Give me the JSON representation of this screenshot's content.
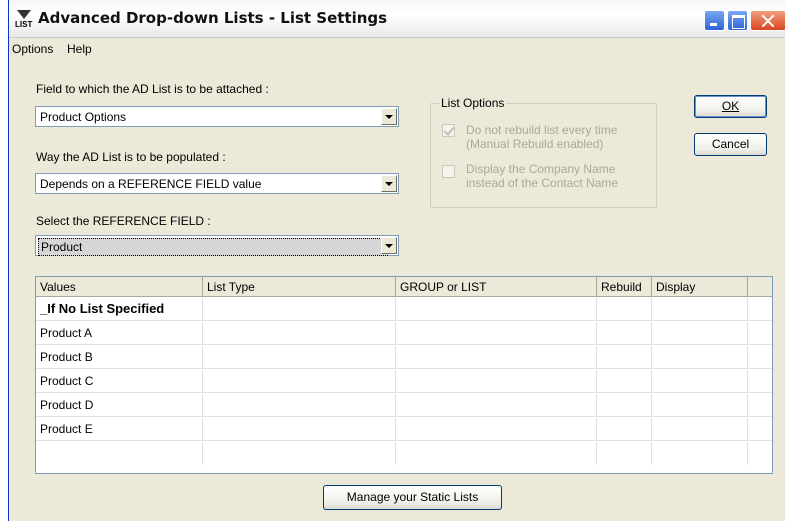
{
  "window": {
    "title": "Advanced Drop-down Lists - List Settings",
    "icon_label": "LIST"
  },
  "menu": {
    "items": [
      "Options",
      "Help"
    ]
  },
  "form": {
    "field_label": "Field to which the AD List is to be attached :",
    "field_value": "Product Options",
    "populate_label": "Way the AD List is to be populated :",
    "populate_value": "Depends on a REFERENCE FIELD value",
    "reference_label": "Select the REFERENCE FIELD :",
    "reference_value": "Product"
  },
  "list_options": {
    "title": "List Options",
    "option1_line1": "Do not rebuild list every time",
    "option1_line2": "(Manual Rebuild enabled)",
    "option1_checked": true,
    "option2_line1": "Display the Company Name",
    "option2_line2": "instead of the Contact Name",
    "option2_checked": false
  },
  "buttons": {
    "ok": "OK",
    "cancel": "Cancel",
    "manage": "Manage your Static Lists"
  },
  "grid": {
    "columns": [
      "Values",
      "List Type",
      "GROUP or LIST",
      "Rebuild",
      "Display"
    ],
    "rows": [
      "_If No List Specified",
      "Product A",
      "Product B",
      "Product C",
      "Product D",
      "Product E"
    ]
  }
}
